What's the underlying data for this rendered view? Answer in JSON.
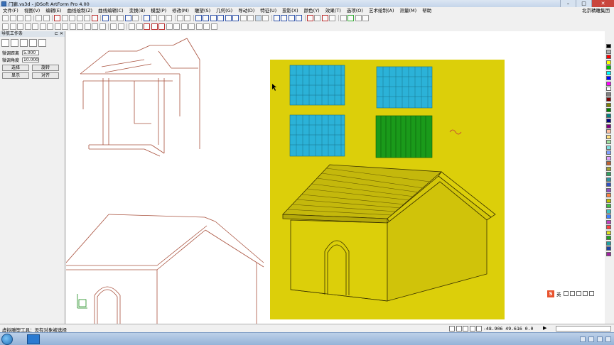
{
  "window": {
    "title": "门廊.vs3d - JDSoft ArtForm Pro 4.00",
    "minimize": "–",
    "maximize": "□",
    "close": "✕"
  },
  "menubar": {
    "items": [
      "文件(F)",
      "视图(V)",
      "编辑(E)",
      "曲线绘制(Z)",
      "曲线编辑(C)",
      "变换(B)",
      "模型(P)",
      "修改(M)",
      "雕塑(S)",
      "几何(G)",
      "导动(D)",
      "特征(U)",
      "投影(X)",
      "颜色(Y)",
      "效果(T)",
      "选项(O)",
      "艺术绘制(A)",
      "测量(M)",
      "帮助"
    ],
    "company": "北京精雕集团"
  },
  "left_panel": {
    "title": "导航工作条",
    "pin": "⊏ ✕",
    "rows": [
      {
        "label": "微调距离",
        "value": "5.000"
      },
      {
        "label": "微调角度",
        "value": "10.000"
      }
    ],
    "buttons": [
      [
        "选择",
        "旋转"
      ],
      [
        "显示",
        "对齐"
      ]
    ]
  },
  "ime": {
    "logo": "S",
    "mode": "英"
  },
  "status": {
    "message": "虚拟雕塑工具：没有对象被选择",
    "coords": "-48.906  49.616 0.0",
    "play": "▶"
  },
  "colors": {
    "model_bg": "#dccf0a",
    "roof_tiles_blue": "#2bb2d8",
    "roof_tiles_green": "#1a9a1a",
    "wire_red": "#a8503c",
    "palette": [
      "#000000",
      "#b0b0b0",
      "#ff0000",
      "#ffff00",
      "#00c000",
      "#00ffff",
      "#0000ff",
      "#ff00ff",
      "#ffffff",
      "#808080",
      "#800000",
      "#808000",
      "#008000",
      "#008080",
      "#000080",
      "#800080",
      "#ffc0a0",
      "#ffe080",
      "#a0e0a0",
      "#80e0e0",
      "#80a0ff",
      "#e0a0ff",
      "#c06030",
      "#a0a030",
      "#30a060",
      "#3090a0",
      "#3050c0",
      "#9050c0",
      "#ff8040",
      "#c0c000",
      "#40c040",
      "#40c0c0",
      "#4080ff",
      "#c040c0",
      "#ff4040",
      "#e0e020",
      "#20a020",
      "#20a0a0",
      "#2040a0",
      "#a020a0"
    ]
  }
}
